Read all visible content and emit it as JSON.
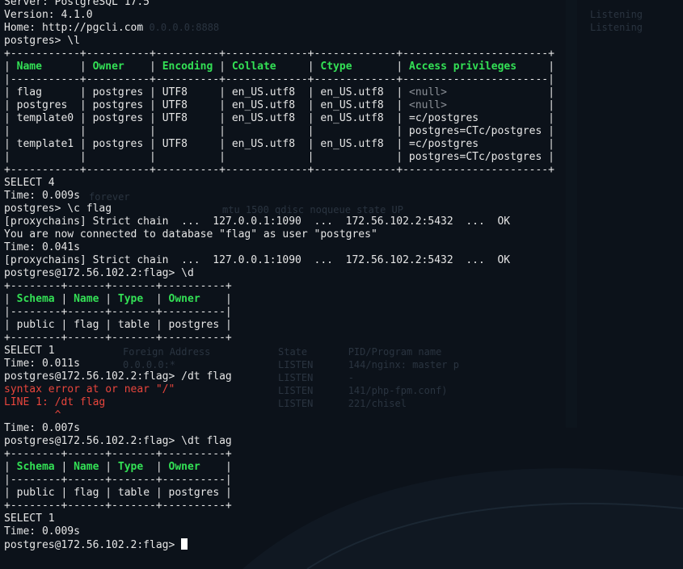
{
  "session": {
    "server_line": "Server: PostgreSQL 17.5",
    "version_line": "Version: 4.1.0",
    "home_line": "Home: http://pgcli.com",
    "cmd_list": "postgres> \\l"
  },
  "db_table": {
    "border_top": "+-----------+----------+----------+-------------+-------------+-----------------------+",
    "header": {
      "name": "Name",
      "owner": "Owner",
      "encoding": "Encoding",
      "collate": "Collate",
      "ctype": "Ctype",
      "access": "Access privileges"
    },
    "border_mid": "|-----------+----------+----------+-------------+-------------+-----------------------|",
    "rows": [
      {
        "name": "flag",
        "owner": "postgres",
        "encoding": "UTF8",
        "collate": "en_US.utf8",
        "ctype": "en_US.utf8",
        "access": "<null>"
      },
      {
        "name": "postgres",
        "owner": "postgres",
        "encoding": "UTF8",
        "collate": "en_US.utf8",
        "ctype": "en_US.utf8",
        "access": "<null>"
      },
      {
        "name": "template0",
        "owner": "postgres",
        "encoding": "UTF8",
        "collate": "en_US.utf8",
        "ctype": "en_US.utf8",
        "access": "=c/postgres"
      },
      {
        "name": "",
        "owner": "",
        "encoding": "",
        "collate": "",
        "ctype": "",
        "access": "postgres=CTc/postgres"
      },
      {
        "name": "template1",
        "owner": "postgres",
        "encoding": "UTF8",
        "collate": "en_US.utf8",
        "ctype": "en_US.utf8",
        "access": "=c/postgres"
      },
      {
        "name": "",
        "owner": "",
        "encoding": "",
        "collate": "",
        "ctype": "",
        "access": "postgres=CTc/postgres"
      }
    ],
    "border_bottom": "+-----------+----------+----------+-------------+-------------+-----------------------+"
  },
  "out1": {
    "select": "SELECT 4",
    "time": "Time: 0.009s"
  },
  "connect": {
    "cmd": "postgres> \\c flag",
    "proxy1": "[proxychains] Strict chain  ...  127.0.0.1:1090  ...  172.56.102.2:5432  ...  OK",
    "connected": "You are now connected to database \"flag\" as user \"postgres\"",
    "time": "Time: 0.041s",
    "proxy2": "[proxychains] Strict chain  ...  127.0.0.1:1090  ...  172.56.102.2:5432  ...  OK"
  },
  "describe": {
    "cmd": "postgres@172.56.102.2:flag> \\d"
  },
  "rel_table": {
    "border_top": "+--------+------+-------+----------+",
    "header": {
      "schema": "Schema",
      "name": "Name",
      "type": "Type",
      "owner": "Owner"
    },
    "border_mid": "|--------+------+-------+----------|",
    "row": {
      "schema": "public",
      "name": "flag",
      "type": "table",
      "owner": "postgres"
    },
    "border_bottom": "+--------+------+-------+----------+"
  },
  "out2": {
    "select": "SELECT 1",
    "time": "Time: 0.011s"
  },
  "error": {
    "cmd": "postgres@172.56.102.2:flag> /dt flag",
    "msg": "syntax error at or near \"/\"",
    "line": "LINE 1: /dt flag",
    "caret": "        ^",
    "time": "Time: 0.007s"
  },
  "dt": {
    "cmd": "postgres@172.56.102.2:flag> \\dt flag"
  },
  "rel_table2": {
    "border_top": "+--------+------+-------+----------+",
    "header": {
      "schema": "Schema",
      "name": "Name",
      "type": "Type",
      "owner": "Owner"
    },
    "border_mid": "|--------+------+-------+----------|",
    "row": {
      "schema": "public",
      "name": "flag",
      "type": "table",
      "owner": "postgres"
    },
    "border_bottom": "+--------+------+-------+----------+"
  },
  "out3": {
    "select": "SELECT 1",
    "time": "Time: 0.009s"
  },
  "prompt": {
    "text": "postgres@172.56.102.2:flag> "
  },
  "background": {
    "lines": [
      "0 0.0.0.0:8888",
      "State       PID/Program name",
      "LISTEN      144/nginx: master p",
      "LISTEN      -",
      "LISTEN      141/php-fpm.conf)",
      "LISTEN      221/chisel",
      "Listening",
      "Listening",
      "Foreign Address",
      "0.0.0.0:*",
      "mtu 1500 qdisc noqueue state UP",
      "forever"
    ]
  },
  "colors": {
    "background": "#0c121a",
    "text": "#e6e6e6",
    "header_green": "#33e055",
    "null_gray": "#8a8f96",
    "error_red": "#e8453c"
  }
}
